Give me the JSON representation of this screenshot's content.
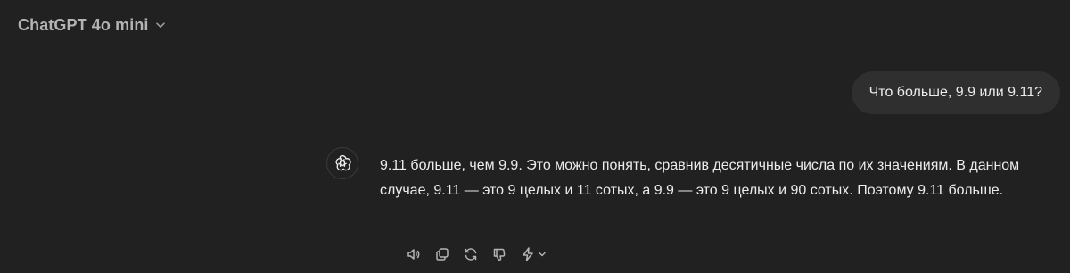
{
  "header": {
    "model_title": "ChatGPT 4o mini",
    "chevron_icon": "chevron-down-icon"
  },
  "user_message": {
    "text": "Что больше, 9.9 или 9.11?"
  },
  "assistant_message": {
    "avatar_icon": "openai-logo-icon",
    "text": "9.11 больше, чем 9.9. Это можно понять, сравнив десятичные числа по их значениям. В данном случае, 9.11 — это 9 целых и 11 сотых, а 9.9 — это 9 целых и 90 сотых. Поэтому 9.11 больше."
  },
  "message_actions": [
    {
      "icon": "speaker-icon"
    },
    {
      "icon": "copy-icon"
    },
    {
      "icon": "regenerate-icon"
    },
    {
      "icon": "thumbs-down-icon"
    },
    {
      "icon": "lightning-icon"
    }
  ],
  "colors": {
    "background": "#212121",
    "bubble": "#2f2f2f",
    "text": "#ececec",
    "muted": "#b4b4b4"
  }
}
